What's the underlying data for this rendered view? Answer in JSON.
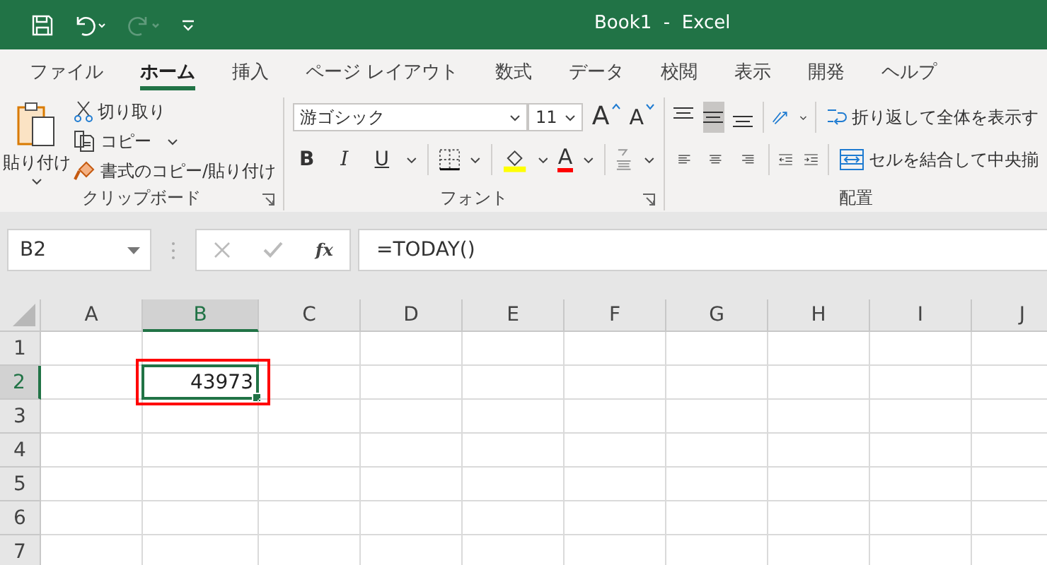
{
  "title_bar": {
    "title": "Book1  -  Excel",
    "redo_enabled": false
  },
  "tabs": [
    {
      "label": "ファイル",
      "selected": false
    },
    {
      "label": "ホーム",
      "selected": true
    },
    {
      "label": "挿入",
      "selected": false
    },
    {
      "label": "ページ レイアウト",
      "selected": false
    },
    {
      "label": "数式",
      "selected": false
    },
    {
      "label": "データ",
      "selected": false
    },
    {
      "label": "校閲",
      "selected": false
    },
    {
      "label": "表示",
      "selected": false
    },
    {
      "label": "開発",
      "selected": false
    },
    {
      "label": "ヘルプ",
      "selected": false
    }
  ],
  "clipboard": {
    "paste": "貼り付け",
    "cut": "切り取り",
    "copy": "コピー",
    "format_painter": "書式のコピー/貼り付け",
    "group_label": "クリップボード"
  },
  "font": {
    "name": "游ゴシック",
    "size": "11",
    "grow": "A",
    "shrink": "A",
    "style_buttons": [
      "B",
      "I",
      "U"
    ],
    "font_color": "A",
    "group_label": "フォント"
  },
  "alignment": {
    "vertical": [
      {
        "kind": "top",
        "selected": false
      },
      {
        "kind": "middle",
        "selected": true
      },
      {
        "kind": "bottom",
        "selected": false
      }
    ],
    "wrap_text": "折り返して全体を表示す",
    "merge": "セルを結合して中央揃",
    "group_label": "配置"
  },
  "formula_bar": {
    "name_box": "B2",
    "fx": "fx",
    "formula": "=TODAY()"
  },
  "sheet": {
    "columns": [
      {
        "label": "A",
        "selected": false
      },
      {
        "label": "B",
        "selected": true
      },
      {
        "label": "C",
        "selected": false
      },
      {
        "label": "D",
        "selected": false
      },
      {
        "label": "E",
        "selected": false
      },
      {
        "label": "F",
        "selected": false
      },
      {
        "label": "G",
        "selected": false
      },
      {
        "label": "H",
        "selected": false
      },
      {
        "label": "I",
        "selected": false
      },
      {
        "label": "J",
        "selected": false
      }
    ],
    "rows": [
      {
        "label": "1",
        "selected": false
      },
      {
        "label": "2",
        "selected": true,
        "cells": [
          {
            "selected": false
          },
          {
            "value": "43973",
            "selected": true,
            "annotated": true
          }
        ]
      },
      {
        "label": "3",
        "selected": false
      },
      {
        "label": "4",
        "selected": false
      },
      {
        "label": "5",
        "selected": false
      },
      {
        "label": "6",
        "selected": false
      },
      {
        "label": "7",
        "selected": false
      }
    ]
  }
}
